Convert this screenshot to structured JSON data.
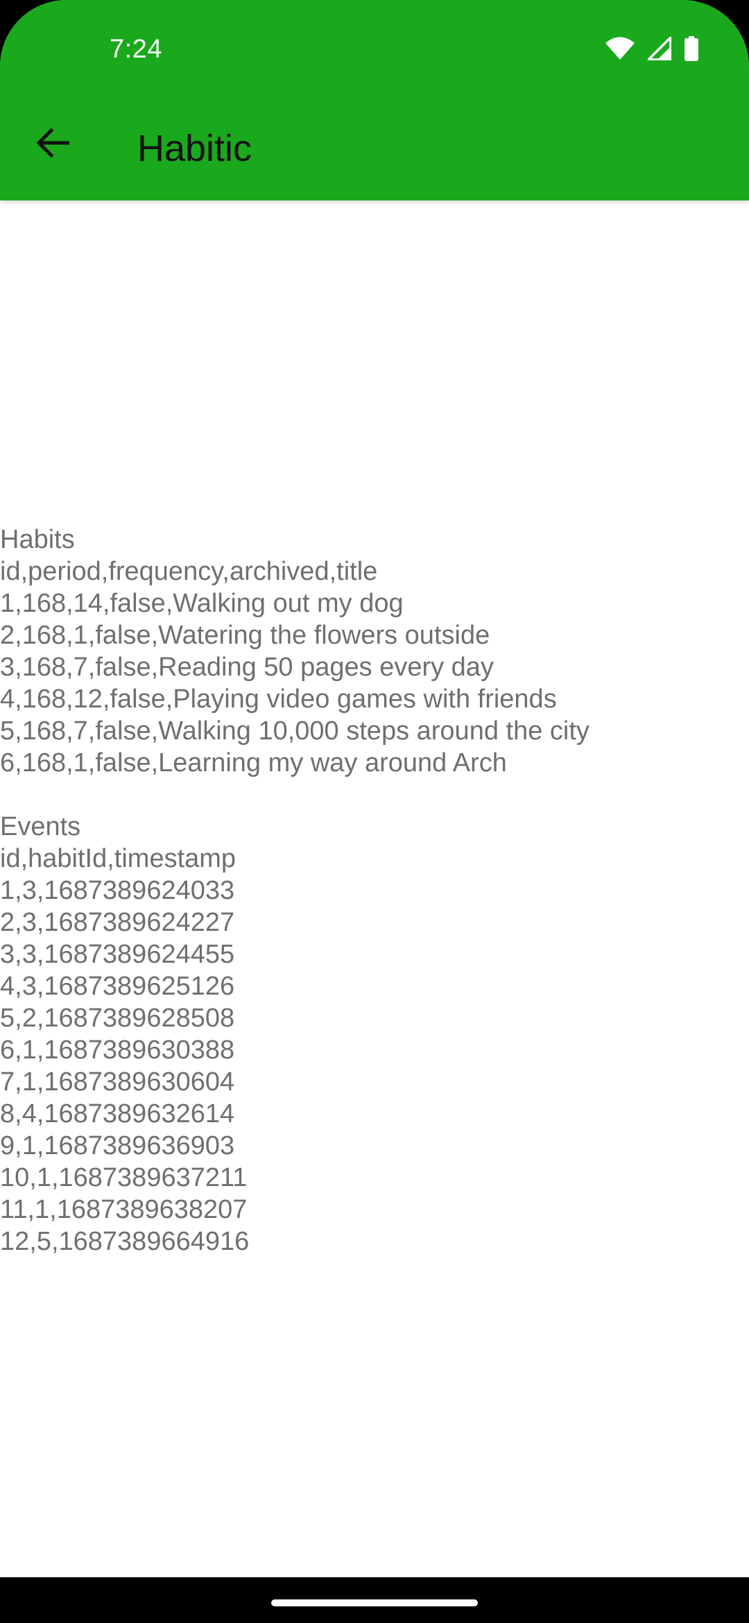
{
  "status_bar": {
    "time": "7:24",
    "icons": [
      "wifi-icon",
      "signal-icon",
      "battery-icon"
    ]
  },
  "app_bar": {
    "title": "Habitic",
    "back_icon": "arrow-back-icon",
    "color": "#1aa91c"
  },
  "export": {
    "habits_heading": "Habits",
    "habits_columns": "id,period,frequency,archived,title",
    "habits_rows": [
      "1,168,14,false,Walking out my dog",
      "2,168,1,false,Watering the flowers outside",
      "3,168,7,false,Reading 50 pages every day",
      "4,168,12,false,Playing video games with friends",
      "5,168,7,false,Walking 10,000 steps around the city",
      "6,168,1,false,Learning my way around Arch"
    ],
    "events_heading": "Events",
    "events_columns": "id,habitId,timestamp",
    "events_rows": [
      "1,3,1687389624033",
      "2,3,1687389624227",
      "3,3,1687389624455",
      "4,3,1687389625126",
      "5,2,1687389628508",
      "6,1,1687389630388",
      "7,1,1687389630604",
      "8,4,1687389632614",
      "9,1,1687389636903",
      "10,1,1687389637211",
      "11,1,1687389638207",
      "12,5,1687389664916"
    ]
  }
}
